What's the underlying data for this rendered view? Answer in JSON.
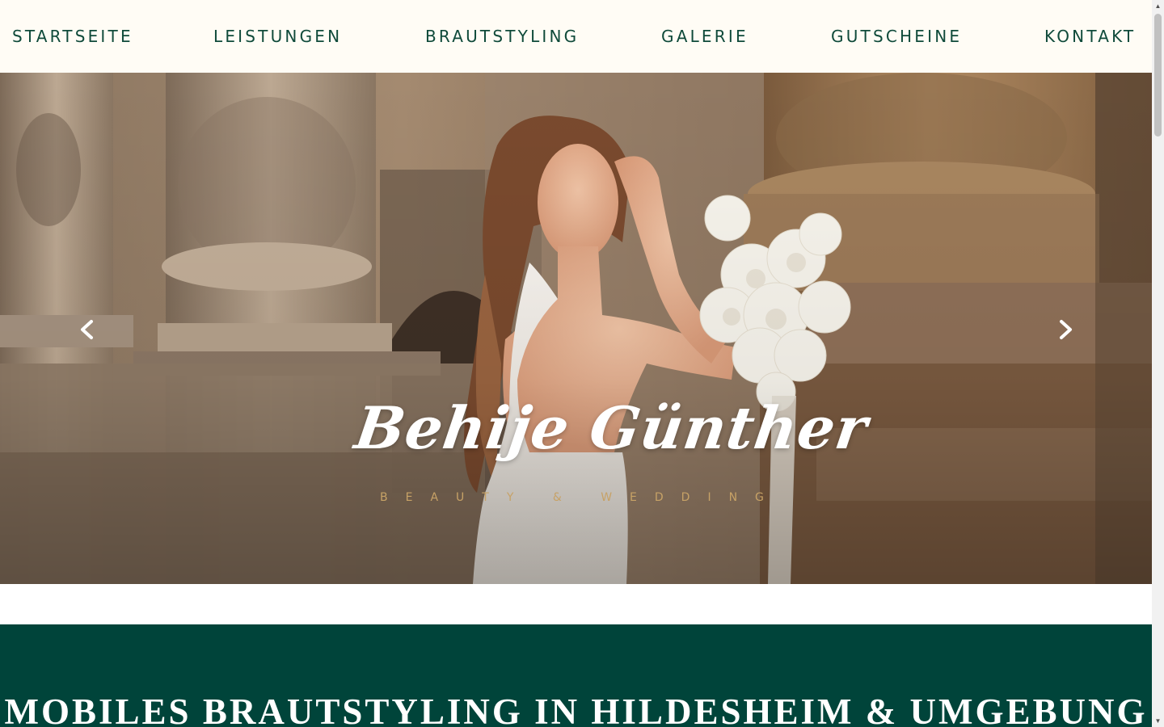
{
  "nav": {
    "items": [
      {
        "label": "STARTSEITE"
      },
      {
        "label": "LEISTUNGEN"
      },
      {
        "label": "BRAUTSTYLING"
      },
      {
        "label": "GALERIE"
      },
      {
        "label": "GUTSCHEINE"
      },
      {
        "label": "KONTAKT"
      }
    ]
  },
  "hero": {
    "logo_script": "Behije Günther",
    "logo_tagline": "BEAUTY & WEDDING",
    "prev_icon": "chevron-left-icon",
    "next_icon": "chevron-right-icon"
  },
  "section": {
    "title": "MOBILES BRAUTSTYLING IN HILDESHEIM & UMGEBUNG"
  },
  "colors": {
    "nav_bg": "#fffcf5",
    "nav_text": "#0f4a3a",
    "band_bg": "#00443a",
    "tagline_gold": "#c7a266"
  }
}
